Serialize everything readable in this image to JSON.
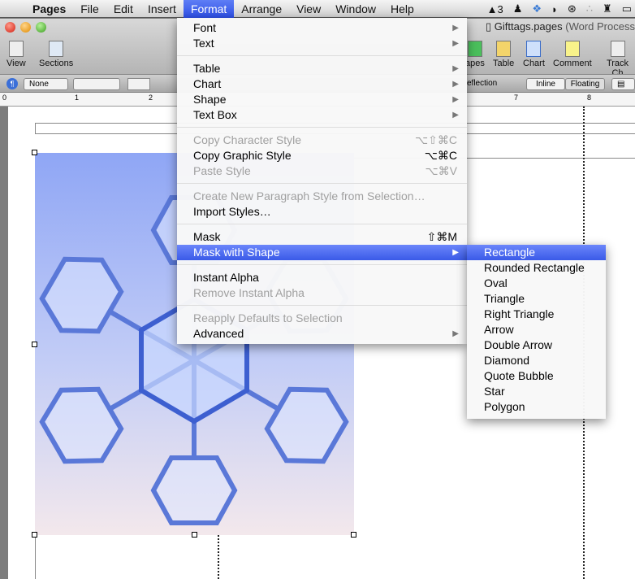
{
  "menubar": {
    "apple": "",
    "app": "Pages",
    "items": [
      "File",
      "Edit",
      "Insert",
      "Format",
      "Arrange",
      "View",
      "Window",
      "Help"
    ],
    "active": "Format",
    "status": {
      "adobe": "3"
    }
  },
  "window": {
    "title": "Gifttags.pages",
    "subtitle": "(Word Process",
    "toolbar_left": [
      {
        "label": "View",
        "icon": "view-icon"
      },
      {
        "label": "Sections",
        "icon": "sections-icon"
      }
    ],
    "toolbar_right": [
      {
        "label": "apes",
        "icon": "shapes-icon"
      },
      {
        "label": "Table",
        "icon": "table-icon"
      },
      {
        "label": "Chart",
        "icon": "chart-icon"
      },
      {
        "label": "Comment",
        "icon": "comment-icon"
      },
      {
        "label": "Track Ch",
        "icon": "track-changes-icon"
      }
    ]
  },
  "formatbar": {
    "style": "None",
    "reflection": "eflection",
    "inline": "Inline",
    "floating": "Floating"
  },
  "ruler": {
    "numbers": [
      "0",
      "1",
      "2",
      "7",
      "8"
    ]
  },
  "format_menu": [
    {
      "label": "Font",
      "submenu": true
    },
    {
      "label": "Text",
      "submenu": true
    },
    {
      "sep": true
    },
    {
      "label": "Table",
      "submenu": true
    },
    {
      "label": "Chart",
      "submenu": true
    },
    {
      "label": "Shape",
      "submenu": true
    },
    {
      "label": "Text Box",
      "submenu": true
    },
    {
      "sep": true
    },
    {
      "label": "Copy Character Style",
      "shortcut": "⌥⇧⌘C",
      "disabled": true
    },
    {
      "label": "Copy Graphic Style",
      "shortcut": "⌥⌘C"
    },
    {
      "label": "Paste Style",
      "shortcut": "⌥⌘V",
      "disabled": true
    },
    {
      "sep": true
    },
    {
      "label": "Create New Paragraph Style from Selection…",
      "disabled": true
    },
    {
      "label": "Import Styles…"
    },
    {
      "sep": true
    },
    {
      "label": "Mask",
      "shortcut": "⇧⌘M"
    },
    {
      "label": "Mask with Shape",
      "submenu": true,
      "highlighted": true
    },
    {
      "sep": true
    },
    {
      "label": "Instant Alpha"
    },
    {
      "label": "Remove Instant Alpha",
      "disabled": true
    },
    {
      "sep": true
    },
    {
      "label": "Reapply Defaults to Selection",
      "disabled": true
    },
    {
      "label": "Advanced",
      "submenu": true
    }
  ],
  "mask_submenu": {
    "items": [
      "Rectangle",
      "Rounded Rectangle",
      "Oval",
      "Triangle",
      "Right Triangle",
      "Arrow",
      "Double Arrow",
      "Diamond",
      "Quote Bubble",
      "Star",
      "Polygon"
    ],
    "highlighted": "Rectangle"
  },
  "colors": {
    "highlight": "#3a5ae8",
    "menubar": "#e0e0e0"
  }
}
